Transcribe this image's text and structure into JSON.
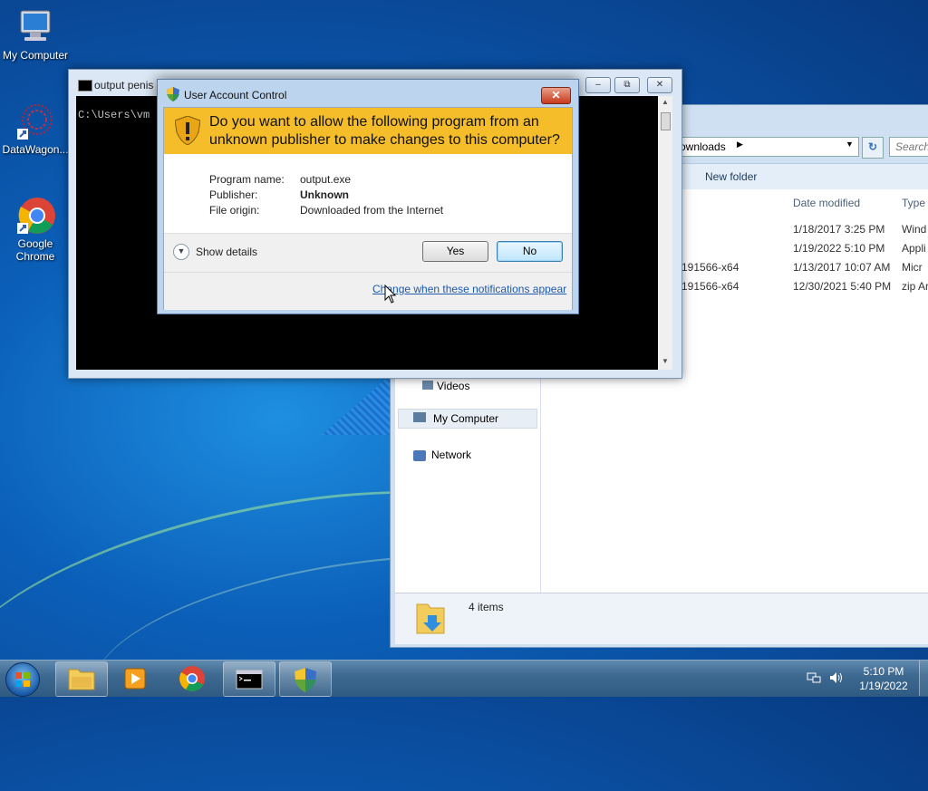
{
  "desktop": {
    "icons": [
      {
        "label": "My Computer"
      },
      {
        "label": "DataWagon..."
      },
      {
        "label": "Google Chrome"
      }
    ]
  },
  "explorer": {
    "breadcrumb": "ownloads",
    "search_placeholder": "Search",
    "toolbar_new_folder": "New folder",
    "columns": [
      "Date modified",
      "Type"
    ],
    "rows": [
      {
        "name": "",
        "date": "1/18/2017 3:25 PM",
        "type": "Wind"
      },
      {
        "name": "",
        "date": "1/19/2022 5:10 PM",
        "type": "Appli"
      },
      {
        "name": "191566-x64",
        "date": "1/13/2017 10:07 AM",
        "type": "Micr"
      },
      {
        "name": "191566-x64",
        "date": "12/30/2021 5:40 PM",
        "type": "zip Ar"
      }
    ],
    "nav": {
      "videos": "Videos",
      "my_computer": "My Computer",
      "network": "Network"
    },
    "status_items": "4 items"
  },
  "cmd": {
    "title": "output  penis",
    "prompt": "C:\\Users\\vm",
    "controls": {
      "minimize": "–",
      "restore": "⧉",
      "close": "✕"
    }
  },
  "uac": {
    "title": "User Account Control",
    "question": "Do you want to allow the following program from an unknown publisher to make changes to this computer?",
    "details": [
      {
        "label": "Program name:",
        "value": "output.exe"
      },
      {
        "label": "Publisher:",
        "value": "Unknown"
      },
      {
        "label": "File origin:",
        "value": "Downloaded from the Internet"
      }
    ],
    "show_details": "Show details",
    "yes_label": "Yes",
    "no_label": "No",
    "notifications_link": "Change when these notifications appear",
    "close_glyph": "✕"
  },
  "taskbar": {
    "time": "5:10 PM",
    "date": "1/19/2022"
  }
}
